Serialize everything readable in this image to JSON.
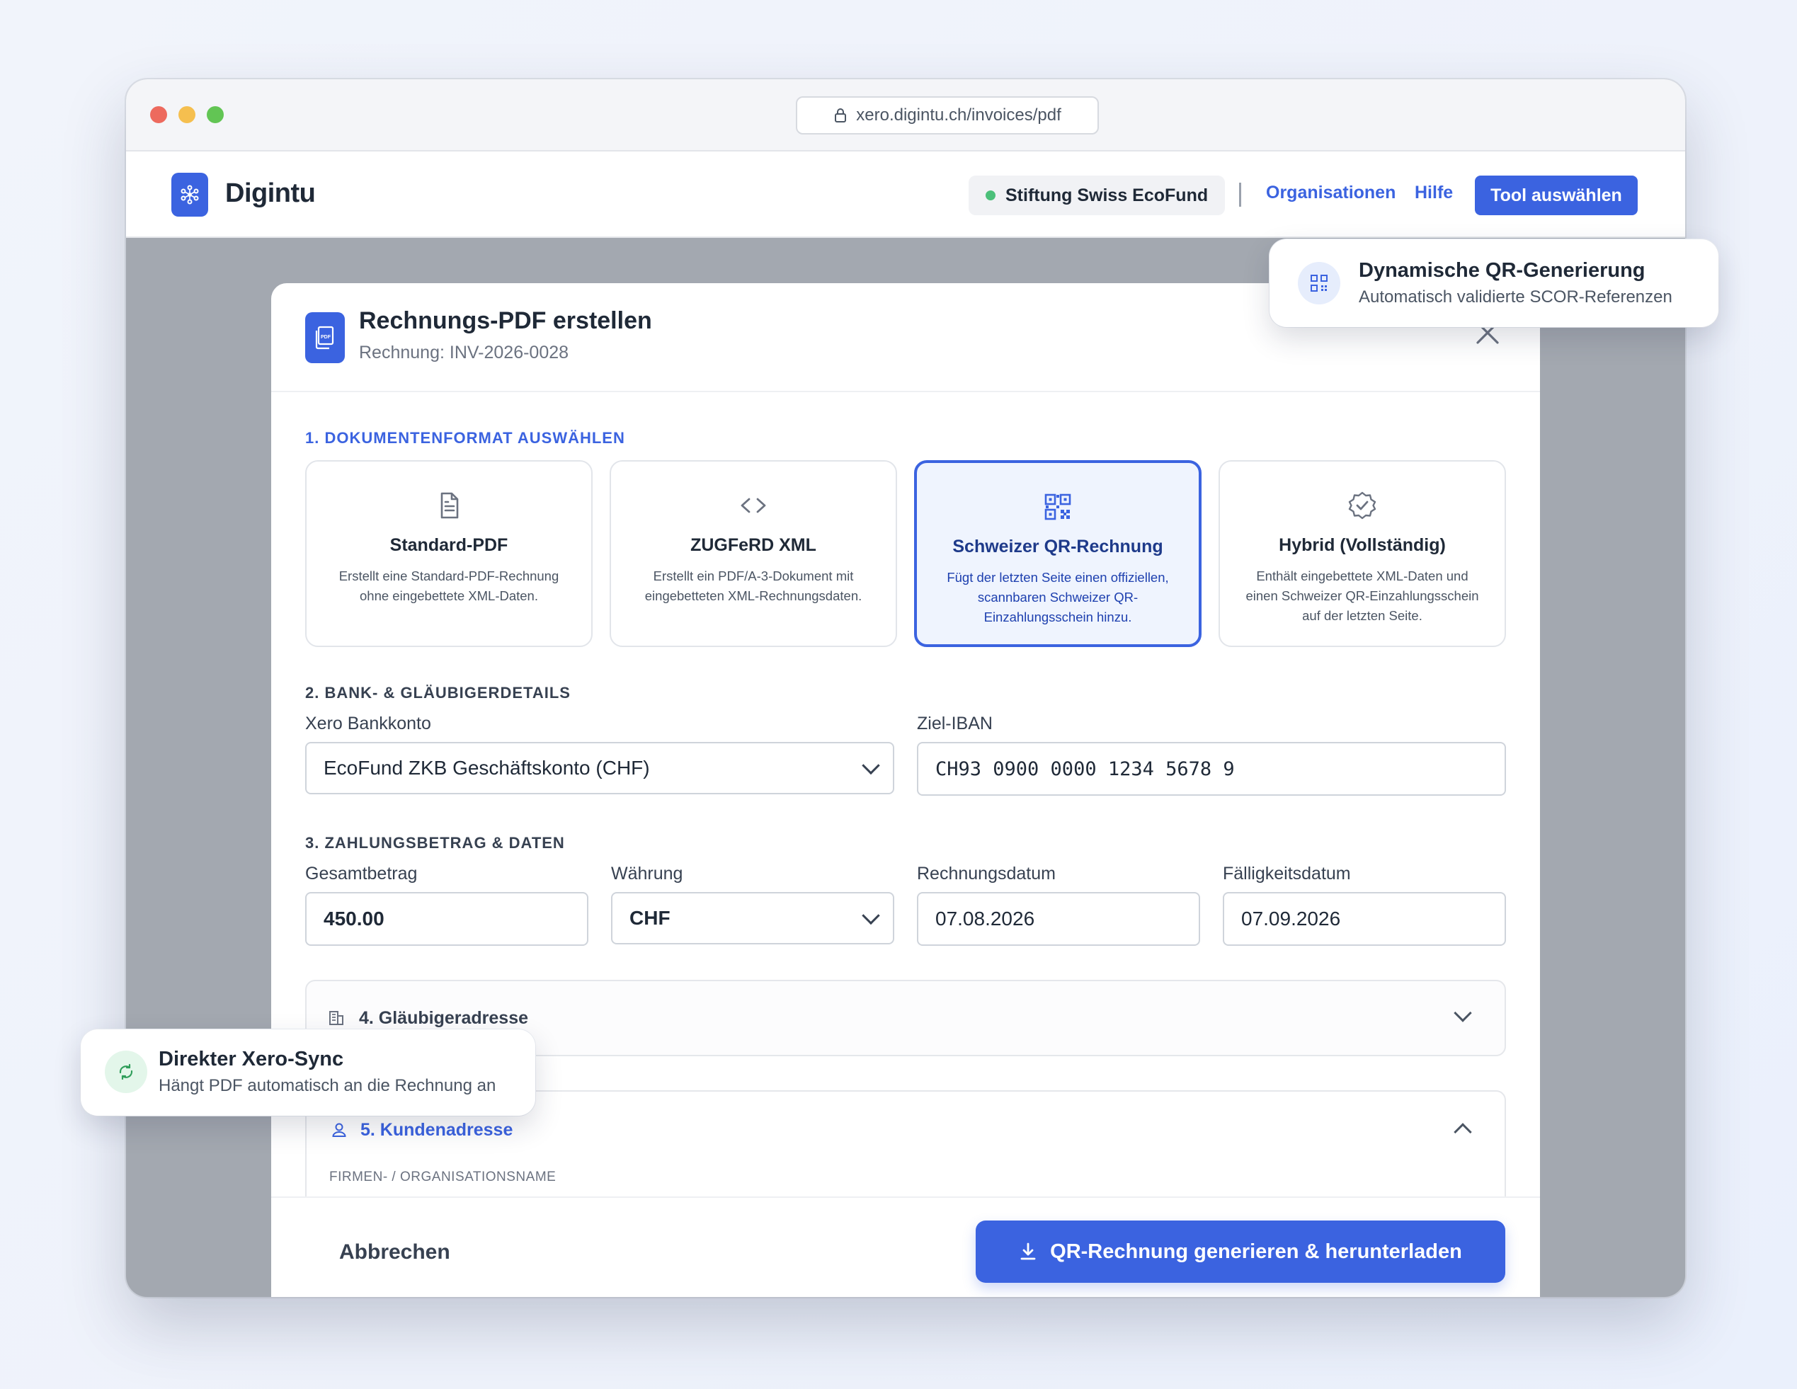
{
  "browser": {
    "url": "xero.digintu.ch/invoices/pdf"
  },
  "appbar": {
    "brand": "Digintu",
    "organization": "Stiftung Swiss EcoFund",
    "nav": {
      "organizations": "Organisationen",
      "help": "Hilfe"
    },
    "tool_button": "Tool auswählen"
  },
  "modal": {
    "title": "Rechnungs-PDF erstellen",
    "subtitle": "Rechnung: INV-2026-0028",
    "section1": {
      "label": "1. DOKUMENTENFORMAT AUSWÄHLEN",
      "cards": [
        {
          "title": "Standard-PDF",
          "desc": "Erstellt eine Standard-PDF-Rechnung ohne eingebettete XML-Daten.",
          "icon": "document-icon",
          "selected": false
        },
        {
          "title": "ZUGFeRD XML",
          "desc": "Erstellt ein PDF/A-3-Dokument mit eingebetteten XML-Rechnungsdaten.",
          "icon": "code-icon",
          "selected": false
        },
        {
          "title": "Schweizer QR-Rechnung",
          "desc": "Fügt der letzten Seite einen offiziellen, scannbaren Schweizer QR-Einzahlungsschein hinzu.",
          "icon": "qr-code-icon",
          "selected": true
        },
        {
          "title": "Hybrid (Vollständig)",
          "desc": "Enthält eingebettete XML-Daten und einen Schweizer QR-Einzahlungsschein auf der letzten Seite.",
          "icon": "verified-badge-icon",
          "selected": false
        }
      ]
    },
    "section2": {
      "label": "2. BANK- & GLÄUBIGERDETAILS",
      "bank_account_label": "Xero Bankkonto",
      "bank_account_value": "EcoFund ZKB Geschäftskonto (CHF)",
      "iban_label": "Ziel-IBAN",
      "iban_value": "CH93 0900 0000 1234 5678 9"
    },
    "section3": {
      "label": "3. ZAHLUNGSBETRAG & DATEN",
      "amount_label": "Gesamtbetrag",
      "amount_value": "450.00",
      "currency_label": "Währung",
      "currency_value": "CHF",
      "invoice_date_label": "Rechnungsdatum",
      "invoice_date_value": "07.08.2026",
      "due_date_label": "Fälligkeitsdatum",
      "due_date_value": "07.09.2026"
    },
    "section4": {
      "title": "4. Gläubigeradresse"
    },
    "section5": {
      "title": "5. Kundenadresse",
      "company_label": "FIRMEN- / ORGANISATIONSNAME"
    },
    "footer": {
      "cancel": "Abbrechen",
      "generate": "QR-Rechnung generieren & herunterladen"
    }
  },
  "toasts": {
    "qr": {
      "title": "Dynamische QR-Generierung",
      "subtitle": "Automatisch validierte SCOR-Referenzen"
    },
    "sync": {
      "title": "Direkter Xero-Sync",
      "subtitle": "Hängt PDF automatisch an die Rechnung an"
    }
  },
  "colors": {
    "accent": "#3b63e0",
    "status_online": "#4cc07a",
    "selected_bg": "#eff4fe"
  }
}
